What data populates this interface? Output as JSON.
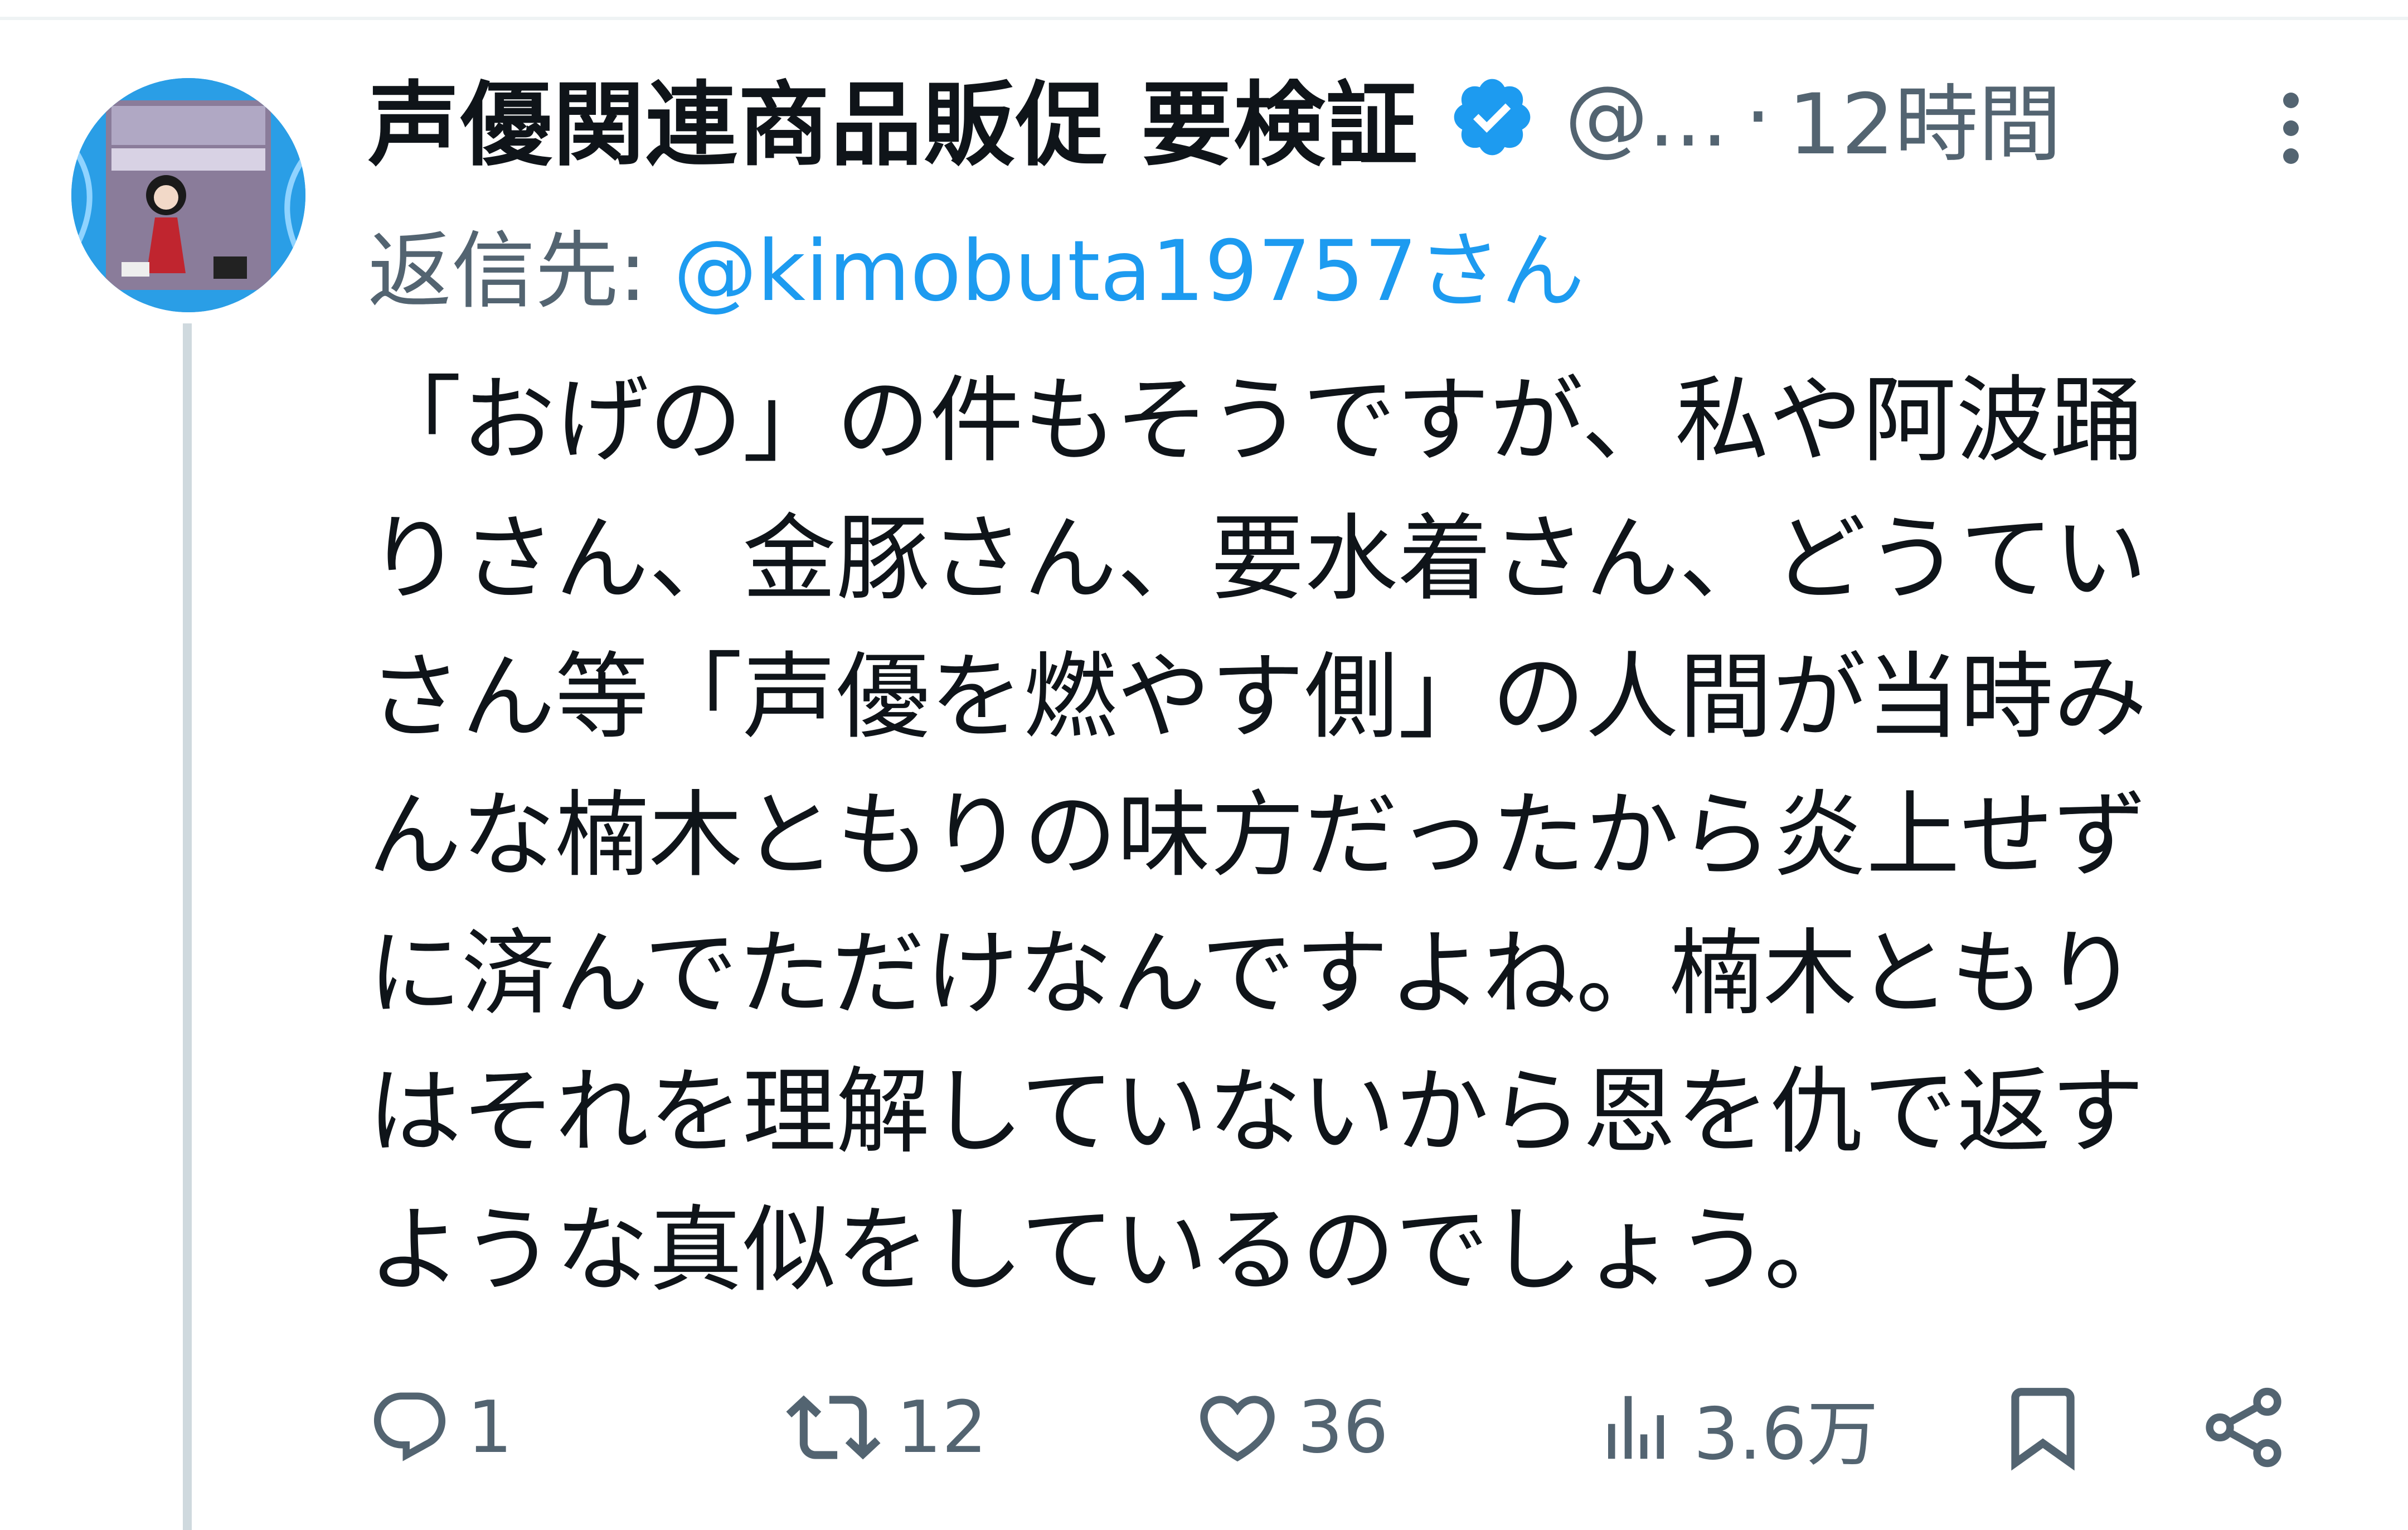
{
  "tweet": {
    "author": {
      "display_name": "声優関連商品販促 要検証",
      "handle": "@...",
      "verified_icon": "verified-badge-icon",
      "avatar_icon": "avatar-image"
    },
    "separator": "·",
    "time": "12時間",
    "reply_to": {
      "prefix": "返信先: ",
      "handle": "@kimobuta19757さん"
    },
    "body_lines": [
      "「おげの」の件もそうですが、私や阿波踊",
      "りさん、金豚さん、要水着さん、どうてい",
      "さん等「声優を燃やす側」の人間が当時み",
      "んな楠木ともりの味方だったから炎上せず",
      "に済んでただけなんですよね。楠木ともり",
      "はそれを理解していないから恩を仇で返す",
      "ような真似をしているのでしょう。"
    ],
    "actions": {
      "reply": {
        "icon": "reply-icon",
        "count": "1"
      },
      "retweet": {
        "icon": "retweet-icon",
        "count": "12"
      },
      "like": {
        "icon": "heart-icon",
        "count": "36"
      },
      "views": {
        "icon": "views-chart-icon",
        "count": "3.6万"
      },
      "bookmark": {
        "icon": "bookmark-icon"
      },
      "share": {
        "icon": "share-icon"
      }
    }
  },
  "colors": {
    "text": "#0f1419",
    "secondary": "#536471",
    "link": "#1d9bf0",
    "thread_line": "#cfd9de"
  }
}
